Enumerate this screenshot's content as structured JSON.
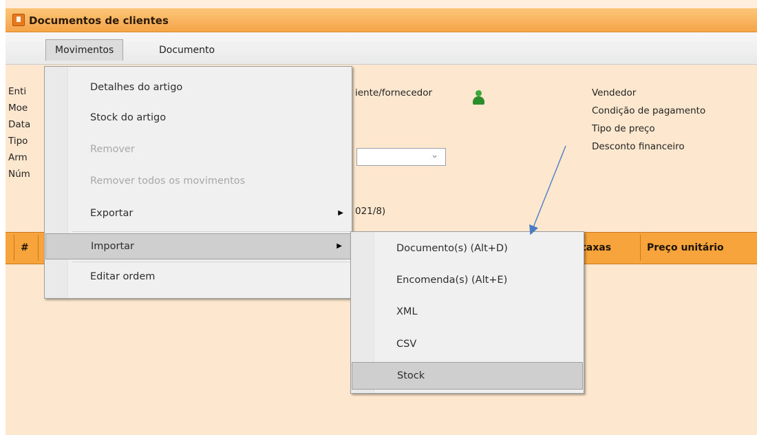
{
  "window": {
    "title": "Documentos de clientes"
  },
  "menubar": {
    "items": [
      "Movimentos",
      "Documento"
    ]
  },
  "form": {
    "left_labels": [
      "Enti",
      "Moe",
      "Data",
      "Tipo",
      "Arm",
      "Núm"
    ],
    "client_label": "iente/fornecedor",
    "number_fragment": "021/8)",
    "right_labels": [
      "Vendedor",
      "Condição de pagamento",
      "Tipo de preço",
      "Desconto financeiro"
    ]
  },
  "table": {
    "headers": [
      "#",
      "/taxas",
      "Preço unitário"
    ]
  },
  "movimentos_menu": {
    "items": [
      {
        "label": "Detalhes do artigo",
        "enabled": true,
        "submenu": false
      },
      {
        "label": "Stock do artigo",
        "enabled": true,
        "submenu": false
      },
      {
        "label": "Remover",
        "enabled": false,
        "submenu": false
      },
      {
        "label": "Remover todos os movimentos",
        "enabled": false,
        "submenu": false
      },
      {
        "label": "Exportar",
        "enabled": true,
        "submenu": true
      },
      {
        "label": "Importar",
        "enabled": true,
        "submenu": true,
        "highlighted": true
      },
      {
        "label": "Editar ordem",
        "enabled": true,
        "submenu": false
      }
    ]
  },
  "importar_submenu": {
    "items": [
      {
        "label": "Documento(s) (Alt+D)"
      },
      {
        "label": "Encomenda(s) (Alt+E)"
      },
      {
        "label": "XML"
      },
      {
        "label": "CSV"
      },
      {
        "label": "Stock",
        "highlighted": true
      }
    ]
  },
  "colors": {
    "titlebar": "#f5a347",
    "background": "#fde8cf",
    "table_header": "#f6a43b",
    "annotation_arrow": "#4a7cc4"
  }
}
